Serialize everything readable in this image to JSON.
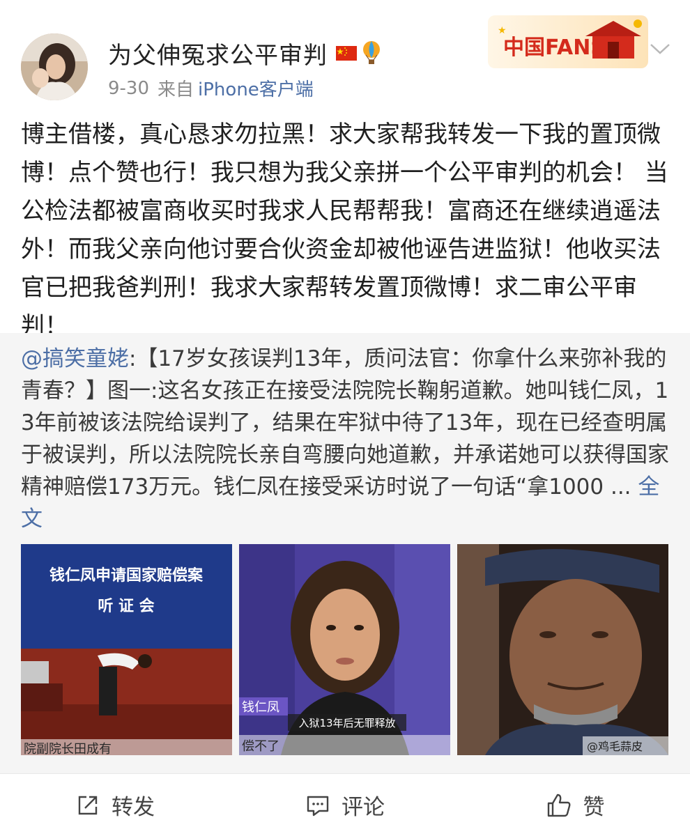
{
  "user": {
    "name": "为父伸冤求公平审判",
    "date": "9-30",
    "source_prefix": "来自",
    "client": "iPhone客户端"
  },
  "badge": {
    "text": "中国FANS"
  },
  "post": {
    "text": "博主借楼，真心恳求勿拉黑！求大家帮我转发一下我的置顶微博！点个赞也行！我只想为我父亲拼一个公平审判的机会！ 当公检法都被富商收买时我求人民帮帮我！富商还在继续逍遥法外！而我父亲向他讨要合伙资金却被他诬告进监狱！他收买法官已把我爸判刑！我求大家帮转发置顶微博！求二审公平审判！"
  },
  "repost": {
    "mention": "@搞笑童姥",
    "separator": ":",
    "text": "【17岁女孩误判13年，质问法官：你拿什么来弥补我的青春？】图一:这名女孩正在接受法院院长鞠躬道歉。她叫钱仁凤，13年前被该法院给误判了，结果在牢狱中待了13年，现在已经查明属于被误判，所以法院院长亲自弯腰向她道歉，并承诺她可以获得国家精神赔偿173万元。钱仁凤在接受采访时说了一句话“拿1000 ... ",
    "fulltext_label": "全文",
    "images": [
      {
        "banner_line1": "钱仁凤申请国家赔偿案",
        "banner_line2": "听  证  会",
        "caption": "院副院长田成有"
      },
      {
        "name_tag": "钱仁凤",
        "subtitle": "入狱13年后无罪释放",
        "caption": "偿不了"
      },
      {
        "watermark": "@鸡毛蒜皮"
      }
    ]
  },
  "actions": {
    "forward": "转发",
    "comment": "评论",
    "like": "赞"
  }
}
